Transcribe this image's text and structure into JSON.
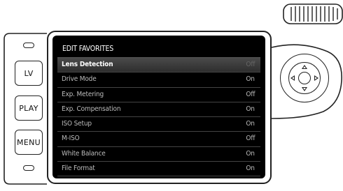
{
  "camera": {
    "buttons": {
      "lv": "LV",
      "play": "PLAY",
      "menu": "MENU"
    }
  },
  "screen": {
    "title": "EDIT FAVORITES",
    "selected_index": 0,
    "items": [
      {
        "label": "Lens Detection",
        "value": "Off"
      },
      {
        "label": "Drive Mode",
        "value": "On"
      },
      {
        "label": "Exp. Metering",
        "value": "Off"
      },
      {
        "label": "Exp. Compensation",
        "value": "On"
      },
      {
        "label": "ISO Setup",
        "value": "On"
      },
      {
        "label": "M-ISO",
        "value": "Off"
      },
      {
        "label": "White Balance",
        "value": "On"
      },
      {
        "label": "File Format",
        "value": "On"
      }
    ]
  },
  "colors": {
    "screen_bg": "#000000",
    "text": "#bdbdbd",
    "selected_text": "#ffffff",
    "outline": "#222222"
  },
  "icons": {
    "dial": "thumb-dial-icon",
    "pad": "directional-pad-icon"
  }
}
